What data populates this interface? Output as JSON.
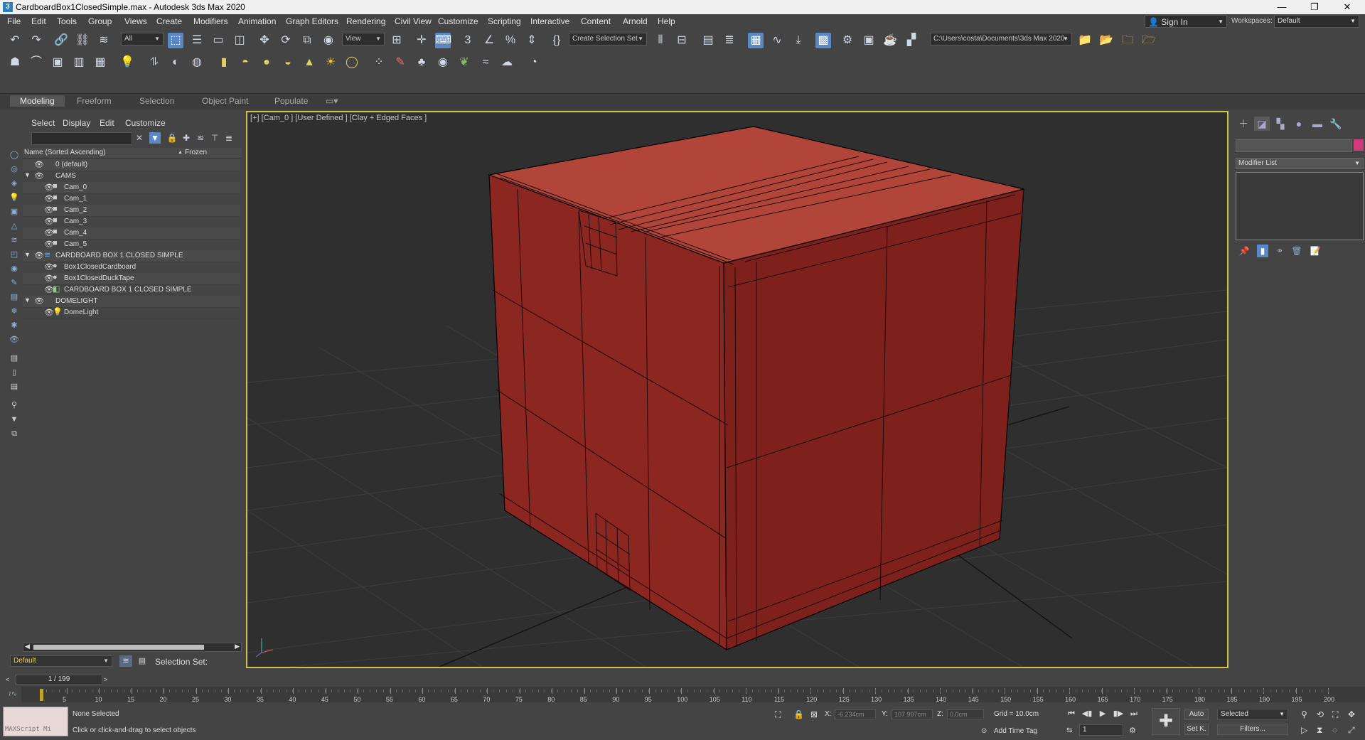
{
  "window": {
    "title": "CardboardBox1ClosedSimple.max - Autodesk 3ds Max 2020",
    "minimize": "—",
    "restore": "❐",
    "close": "✕"
  },
  "menu": [
    "File",
    "Edit",
    "Tools",
    "Group",
    "Views",
    "Create",
    "Modifiers",
    "Animation",
    "Graph Editors",
    "Rendering",
    "Civil View",
    "Customize",
    "Scripting",
    "Interactive",
    "Content",
    "Arnold",
    "Help"
  ],
  "account": {
    "signin": "Sign In",
    "workspaces_label": "Workspaces:",
    "workspace": "Default"
  },
  "toolbar": {
    "selection_filter": "All",
    "ref_coord": "View",
    "named_selection": "Create Selection Set",
    "project_path": "C:\\Users\\costa\\Documents\\3ds Max 2020"
  },
  "ribbon_tabs": [
    "Modeling",
    "Freeform",
    "Selection",
    "Object Paint",
    "Populate"
  ],
  "explorer": {
    "menu": [
      "Select",
      "Display",
      "Edit",
      "Customize"
    ],
    "col_name": "Name (Sorted Ascending)",
    "col_sort": "▲",
    "col_frozen": "Frozen",
    "rows": [
      {
        "label": "0 (default)"
      },
      {
        "label": "CAMS"
      },
      {
        "label": "Cam_0"
      },
      {
        "label": "Cam_1"
      },
      {
        "label": "Cam_2"
      },
      {
        "label": "Cam_3"
      },
      {
        "label": "Cam_4"
      },
      {
        "label": "Cam_5"
      },
      {
        "label": "CARDBOARD BOX 1 CLOSED SIMPLE"
      },
      {
        "label": "Box1ClosedCardboard"
      },
      {
        "label": "Box1ClosedDuckTape"
      },
      {
        "label": "CARDBOARD BOX 1 CLOSED SIMPLE"
      },
      {
        "label": "DOMELIGHT"
      },
      {
        "label": "DomeLight"
      }
    ]
  },
  "viewport": {
    "label": "[+] [Cam_0 ] [User Defined ] [Clay + Edged Faces ]",
    "box_color": "#8b2620",
    "box_top_color": "#b2453a",
    "border_color": "#cfc24a"
  },
  "command_panel": {
    "modifier_list": "Modifier List",
    "object_color": "#d23a7c"
  },
  "bottom": {
    "layer": "Default",
    "selection_set_label": "Selection Set:",
    "time_position": "1 / 199",
    "ticks": [
      "5",
      "10",
      "15",
      "20",
      "25",
      "30",
      "35",
      "40",
      "45",
      "50",
      "55",
      "60",
      "65",
      "70",
      "75",
      "80",
      "85",
      "90",
      "95",
      "100",
      "105",
      "110",
      "115",
      "120",
      "125",
      "130",
      "135",
      "140",
      "145",
      "150",
      "155",
      "160",
      "165",
      "170",
      "175",
      "180",
      "185",
      "190",
      "195",
      "200"
    ],
    "maxscript": "MAXScript Mi",
    "status_selected": "None Selected",
    "status_prompt": "Click or click-and-drag to select objects",
    "x_label": "X:",
    "x_value": "-6.234cm",
    "y_label": "Y:",
    "y_value": "107.997cm",
    "z_label": "Z:",
    "z_value": "0.0cm",
    "grid": "Grid = 10.0cm",
    "add_time_tag": "Add Time Tag",
    "auto": "Auto",
    "set_key": "Set K.",
    "key_mode": "Selected",
    "filters": "Filters...",
    "current_frame": "1"
  }
}
